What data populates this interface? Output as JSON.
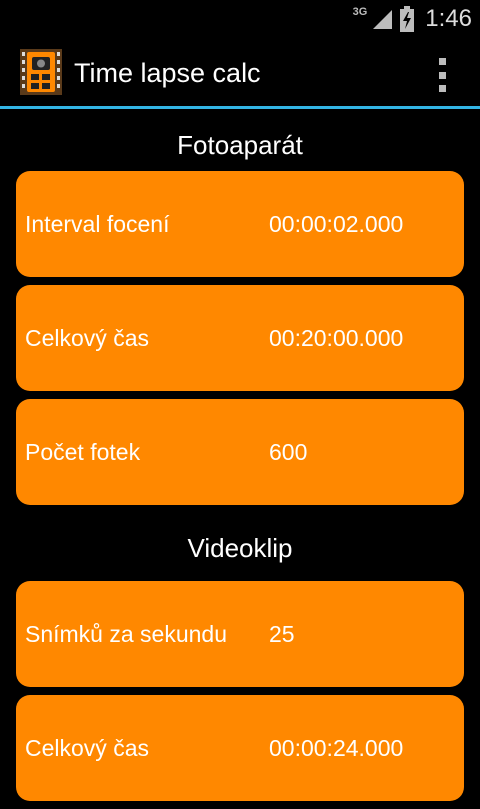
{
  "status_bar": {
    "network": "3G",
    "time": "1:46",
    "icons": [
      "signal-icon",
      "battery-charging-icon"
    ]
  },
  "action_bar": {
    "title": "Time lapse calc",
    "app_icon": "camera-calculator-icon",
    "menu_icon": "overflow-menu-icon"
  },
  "camera_section": {
    "title": "Fotoaparát",
    "rows": [
      {
        "label": "Interval focení",
        "value": "00:00:02.000"
      },
      {
        "label": "Celkový čas",
        "value": "00:20:00.000"
      },
      {
        "label": "Počet fotek",
        "value": "600"
      }
    ]
  },
  "video_section": {
    "title": "Videoklip",
    "rows": [
      {
        "label": "Snímků za sekundu",
        "value": "25"
      },
      {
        "label": "Celkový čas",
        "value": "00:00:24.000"
      }
    ]
  },
  "colors": {
    "card_background": "#ff8800",
    "action_bar_divider": "#33b5e5",
    "background": "#000000"
  }
}
